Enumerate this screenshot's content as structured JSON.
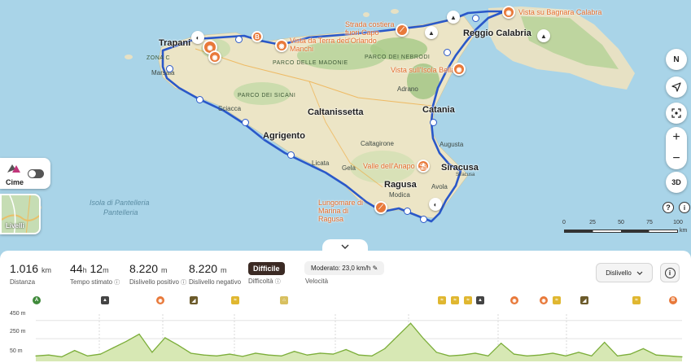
{
  "map": {
    "cities": {
      "trapani": "Trapani",
      "caltanissetta": "Caltanissetta",
      "agrigento": "Agrigento",
      "catania": "Catania",
      "siracusa": "Siracusa",
      "ragusa": "Ragusa",
      "reggio": "Reggio Calabria",
      "marsala": "Marsala",
      "sciacca": "Sciacca",
      "adrano": "Adrano",
      "caltagirone": "Caltagirone",
      "modica": "Modica",
      "gela": "Gela",
      "licata": "Licata",
      "augusta": "Augusta",
      "avola": "Avola",
      "siracusa_small": "Siracusa"
    },
    "areas": {
      "madonie": "PARCO DELLE MADONIE",
      "nebrodi": "PARCO DEI NEBRODI",
      "sicani": "PARCO DEI SICANI",
      "zona": "ZONA C"
    },
    "pois": {
      "terra": "Vista da Terra dei Manchi",
      "strada": "Strada costiera fuori Capo d'Orlando",
      "bella": "Vista sull'Isola Bella",
      "bagnara": "Vista su Bagnara Calabra",
      "anapo": "Valle dell'Anapo",
      "lungomare": "Lungomare di Marina di Ragusa"
    },
    "sea": {
      "pantelleria": "Isola di Pantelleria",
      "pantelleria2": "Pantelleria"
    },
    "start_marker": "B",
    "controls": {
      "compass": "N",
      "zoom_in": "+",
      "zoom_out": "−",
      "three_d": "3D",
      "help": "?"
    },
    "scale": {
      "ticks": [
        "0",
        "25",
        "50",
        "75",
        "100"
      ],
      "unit": "km"
    },
    "cime_label": "Cime",
    "layers_label": "Livelli"
  },
  "stats": {
    "distance": {
      "value": "1.016",
      "unit": "km",
      "caption": "Distanza"
    },
    "time": {
      "hours": "44",
      "h_unit": "h",
      "minutes": "12",
      "m_unit": "m",
      "caption": "Tempo stimato"
    },
    "ascent": {
      "value": "8.220",
      "unit": "m",
      "caption": "Dislivello positivo"
    },
    "descent": {
      "value": "8.220",
      "unit": "m",
      "caption": "Dislivello negativo"
    },
    "difficulty": {
      "value": "Difficile",
      "caption": "Difficoltà"
    },
    "speed": {
      "value": "Moderato: 23,0 km/h",
      "caption": "Velocità"
    },
    "dropdown": "Dislivello",
    "info": "i"
  },
  "chart_data": {
    "type": "area",
    "title": "",
    "xlabel": "",
    "ylabel": "",
    "ylim": [
      0,
      520
    ],
    "yticks": [
      "450 m",
      "250 m",
      "50 m"
    ],
    "line_color": "#7cae3a",
    "fill_color": "#d7e8b4",
    "x": [
      0,
      2,
      4,
      6,
      8,
      10,
      12,
      14,
      16,
      18,
      20,
      22,
      24,
      26,
      28,
      30,
      32,
      34,
      36,
      38,
      40,
      42,
      44,
      46,
      48,
      50,
      52,
      54,
      56,
      58,
      60,
      62,
      64,
      66,
      68,
      70,
      72,
      74,
      76,
      78,
      80,
      82,
      84,
      86,
      88,
      90,
      92,
      94,
      96,
      98,
      100
    ],
    "values": [
      60,
      70,
      50,
      120,
      60,
      80,
      150,
      220,
      300,
      100,
      260,
      180,
      90,
      70,
      60,
      80,
      55,
      90,
      70,
      60,
      110,
      70,
      90,
      80,
      130,
      70,
      60,
      140,
      280,
      420,
      250,
      100,
      60,
      70,
      90,
      60,
      200,
      80,
      60,
      70,
      90,
      60,
      100,
      60,
      210,
      60,
      80,
      140,
      70,
      60,
      50
    ]
  },
  "route_icons": [
    {
      "label": "A",
      "color": "#3f8a3a",
      "round": true
    },
    {
      "label": "▲",
      "color": "#444",
      "round": false
    },
    {
      "label": "◉",
      "color": "#e8793a",
      "round": true
    },
    {
      "label": "◢",
      "color": "#6b5a2a",
      "round": false
    },
    {
      "label": "≈",
      "color": "#e0b730",
      "round": false
    },
    {
      "label": "⌂",
      "color": "#d8c060",
      "round": false
    },
    {
      "label": "≈",
      "color": "#e0b730",
      "round": false
    },
    {
      "label": "≈",
      "color": "#e0b730",
      "round": false
    },
    {
      "label": "≈",
      "color": "#e0b730",
      "round": false
    },
    {
      "label": "▲",
      "color": "#444",
      "round": false
    },
    {
      "label": "◉",
      "color": "#e8793a",
      "round": true
    },
    {
      "label": "◉",
      "color": "#e8793a",
      "round": true
    },
    {
      "label": "≈",
      "color": "#e0b730",
      "round": false
    },
    {
      "label": "◢",
      "color": "#6b5a2a",
      "round": false
    },
    {
      "label": "≈",
      "color": "#e0b730",
      "round": false
    },
    {
      "label": "B",
      "color": "#e8793a",
      "round": true
    }
  ],
  "colors": {
    "route": "#2a58c9",
    "accent": "#e8793a",
    "sea": "#a9d4e8",
    "land": "#e9e4c9",
    "forest": "#b7d39a"
  }
}
